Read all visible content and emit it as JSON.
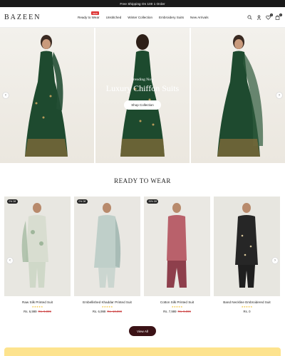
{
  "announcement": "Free Shipping On 100 1 Order",
  "brand": "BAZEEN",
  "nav": [
    {
      "label": "Ready to Wear",
      "badge": "NEW"
    },
    {
      "label": "Unstitched"
    },
    {
      "label": "Winter Collection"
    },
    {
      "label": "Embroidery Suits"
    },
    {
      "label": "New Arrivals"
    }
  ],
  "header_icons": {
    "search": "search-icon",
    "account": "user-icon",
    "wishlist": "heart-icon",
    "wishlist_count": "0",
    "cart": "bag-icon",
    "cart_count": "0"
  },
  "hero": {
    "kicker": "Trending Now",
    "title": "Luxury Chiffon Suits",
    "button": "Shop Collection",
    "prev": "‹",
    "next": "›"
  },
  "section": {
    "title": "READY TO WEAR",
    "view_all": "View All"
  },
  "products": [
    {
      "name": "Raw Silk Printed Suit",
      "badge": "0% Off",
      "stars": "★★★★★",
      "price": "Rs. 6,999",
      "old_price": "Rs. 9,999"
    },
    {
      "name": "Embellished Khaddar Printed Suit",
      "badge": "0% Off",
      "stars": "★★★★★",
      "price": "Rs. 6,999",
      "old_price": "Rs. 10,999"
    },
    {
      "name": "Cotton Silk Printed Suit",
      "badge": "20% Off",
      "stars": "★★★★★",
      "price": "Rs. 7,999",
      "old_price": "Rs. 9,999"
    },
    {
      "name": "Band Neckline Embroidered Suit",
      "badge": "",
      "stars": "★★★★★",
      "price": "Rs. 0",
      "old_price": ""
    }
  ],
  "colors": {
    "accent": "#3b1216",
    "dress_green": "#1e4a2f",
    "promo": "#fde38e"
  }
}
